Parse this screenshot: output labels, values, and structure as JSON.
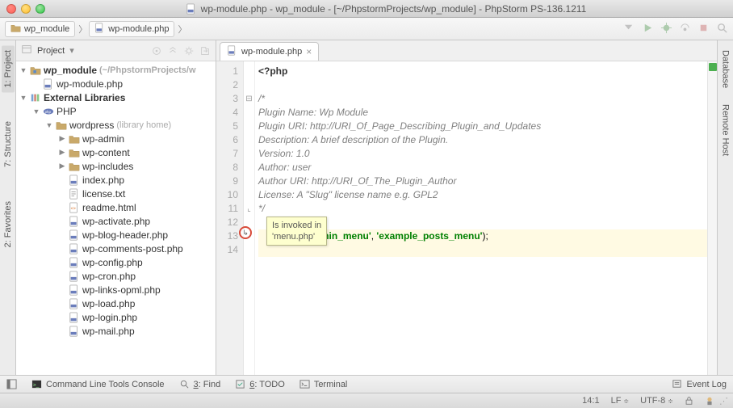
{
  "window": {
    "title": "wp-module.php - wp_module - [~/PhpstormProjects/wp_module] - PhpStorm PS-136.1211"
  },
  "breadcrumbs": [
    {
      "kind": "folder",
      "label": "wp_module"
    },
    {
      "kind": "php",
      "label": "wp-module.php"
    }
  ],
  "left_tabs": [
    {
      "label": "1: Project",
      "active": true
    },
    {
      "label": "7: Structure",
      "active": false
    },
    {
      "label": "2: Favorites",
      "active": false
    }
  ],
  "right_tabs": [
    {
      "label": "Database"
    },
    {
      "label": "Remote Host"
    }
  ],
  "project_panel": {
    "title": "Project",
    "tree": [
      {
        "depth": 0,
        "kind": "module",
        "arrow": "down",
        "bold": true,
        "label": "wp_module",
        "suffix": " (~/PhpstormProjects/w"
      },
      {
        "depth": 1,
        "kind": "php",
        "arrow": "",
        "label": "wp-module.php"
      },
      {
        "depth": 0,
        "kind": "libs",
        "arrow": "down",
        "bold": true,
        "label": "External Libraries"
      },
      {
        "depth": 1,
        "kind": "phplib",
        "arrow": "down",
        "label": "PHP"
      },
      {
        "depth": 2,
        "kind": "folder",
        "arrow": "down",
        "label": "wordpress",
        "hint": "(library home)"
      },
      {
        "depth": 3,
        "kind": "folder",
        "arrow": "right",
        "label": "wp-admin"
      },
      {
        "depth": 3,
        "kind": "folder",
        "arrow": "right",
        "label": "wp-content"
      },
      {
        "depth": 3,
        "kind": "folder",
        "arrow": "right",
        "label": "wp-includes"
      },
      {
        "depth": 3,
        "kind": "php",
        "arrow": "",
        "label": "index.php"
      },
      {
        "depth": 3,
        "kind": "txt",
        "arrow": "",
        "label": "license.txt"
      },
      {
        "depth": 3,
        "kind": "html",
        "arrow": "",
        "label": "readme.html"
      },
      {
        "depth": 3,
        "kind": "php",
        "arrow": "",
        "label": "wp-activate.php"
      },
      {
        "depth": 3,
        "kind": "php",
        "arrow": "",
        "label": "wp-blog-header.php"
      },
      {
        "depth": 3,
        "kind": "php",
        "arrow": "",
        "label": "wp-comments-post.php"
      },
      {
        "depth": 3,
        "kind": "php",
        "arrow": "",
        "label": "wp-config.php"
      },
      {
        "depth": 3,
        "kind": "php",
        "arrow": "",
        "label": "wp-cron.php"
      },
      {
        "depth": 3,
        "kind": "php",
        "arrow": "",
        "label": "wp-links-opml.php"
      },
      {
        "depth": 3,
        "kind": "php",
        "arrow": "",
        "label": "wp-load.php"
      },
      {
        "depth": 3,
        "kind": "php",
        "arrow": "",
        "label": "wp-login.php"
      },
      {
        "depth": 3,
        "kind": "php",
        "arrow": "",
        "label": "wp-mail.php"
      }
    ]
  },
  "editor": {
    "tab_label": "wp-module.php",
    "lines": {
      "1": "<?php",
      "2": "",
      "3": "/*",
      "4": "Plugin Name: Wp Module",
      "5": "Plugin URI: http://URI_Of_Page_Describing_Plugin_and_Updates",
      "6": "Description: A brief description of the Plugin.",
      "7": "Version: 1.0",
      "8": "Author: user",
      "9": "Author URI: http://URI_Of_The_Plugin_Author",
      "10": "License: A \"Slug\" license name e.g. GPL2",
      "11": "*/",
      "12": "",
      "13_str1": "'admin_menu'",
      "13_sep": ", ",
      "13_str2": "'example_posts_menu'",
      "13_end": ");",
      "14": ""
    },
    "line_count": 14,
    "caret_line": 14,
    "tooltip": {
      "line1": "Is invoked in",
      "line2": "'menu.php'"
    }
  },
  "bottom": {
    "cmdline": "Command Line Tools Console",
    "find": "3: Find",
    "todo": "6: TODO",
    "terminal": "Terminal",
    "eventlog": "Event Log"
  },
  "status": {
    "pos": "14:1",
    "line_sep": "LF",
    "encoding": "UTF-8",
    "git": "",
    "lock": "a"
  }
}
